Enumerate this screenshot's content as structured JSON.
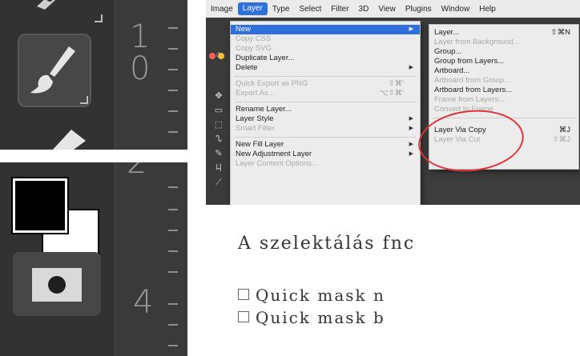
{
  "brush_panel": {
    "ruler_numbers": [
      "1",
      "0"
    ]
  },
  "colors_panel": {
    "ruler_numbers": [
      "2",
      "4"
    ]
  },
  "menu_shot": {
    "menubar": [
      "Image",
      "Layer",
      "Type",
      "Select",
      "Filter",
      "3D",
      "View",
      "Plugins",
      "Window",
      "Help"
    ],
    "active_menu": "Layer",
    "layer_menu": [
      {
        "label": "New",
        "shortcut": "",
        "arrow": true,
        "state": "highlighted"
      },
      {
        "label": "Copy CSS",
        "shortcut": "",
        "arrow": false,
        "state": "disabled"
      },
      {
        "label": "Copy SVG",
        "shortcut": "",
        "arrow": false,
        "state": "disabled"
      },
      {
        "label": "Duplicate Layer...",
        "shortcut": "",
        "arrow": false,
        "state": "enabled"
      },
      {
        "label": "Delete",
        "shortcut": "",
        "arrow": true,
        "state": "enabled"
      },
      {
        "label": "Quick Export as PNG",
        "shortcut": "⇧⌘'",
        "arrow": false,
        "state": "disabled"
      },
      {
        "label": "Export As...",
        "shortcut": "⌥⇧⌘'",
        "arrow": false,
        "state": "disabled"
      },
      {
        "label": "Rename Layer...",
        "shortcut": "",
        "arrow": false,
        "state": "enabled"
      },
      {
        "label": "Layer Style",
        "shortcut": "",
        "arrow": true,
        "state": "enabled"
      },
      {
        "label": "Smart Filter",
        "shortcut": "",
        "arrow": true,
        "state": "disabled"
      },
      {
        "label": "New Fill Layer",
        "shortcut": "",
        "arrow": true,
        "state": "enabled"
      },
      {
        "label": "New Adjustment Layer",
        "shortcut": "",
        "arrow": true,
        "state": "enabled"
      },
      {
        "label": "Layer Content Options...",
        "shortcut": "",
        "arrow": false,
        "state": "disabled"
      }
    ],
    "new_submenu": [
      {
        "label": "Layer...",
        "shortcut": "⇧⌘N",
        "state": "enabled"
      },
      {
        "label": "Layer from Background...",
        "shortcut": "",
        "state": "disabled"
      },
      {
        "label": "Group...",
        "shortcut": "",
        "state": "enabled"
      },
      {
        "label": "Group from Layers...",
        "shortcut": "",
        "state": "enabled"
      },
      {
        "label": "Artboard...",
        "shortcut": "",
        "state": "enabled"
      },
      {
        "label": "Artboard from Group...",
        "shortcut": "",
        "state": "disabled"
      },
      {
        "label": "Artboard from Layers...",
        "shortcut": "",
        "state": "enabled"
      },
      {
        "label": "Frame from Layers...",
        "shortcut": "",
        "state": "disabled"
      },
      {
        "label": "Convert to Frame",
        "shortcut": "",
        "state": "disabled"
      },
      {
        "label": "Layer Via Copy",
        "shortcut": "⌘J",
        "state": "enabled"
      },
      {
        "label": "Layer Via Cut",
        "shortcut": "⇧⌘J",
        "state": "disabled"
      }
    ],
    "highlight_color": "#2f6fde",
    "annotation_color": "#e0353a"
  },
  "question": {
    "text": "A szelektálás fnc",
    "options": [
      "Quick mask n",
      "Quick mask b"
    ]
  }
}
